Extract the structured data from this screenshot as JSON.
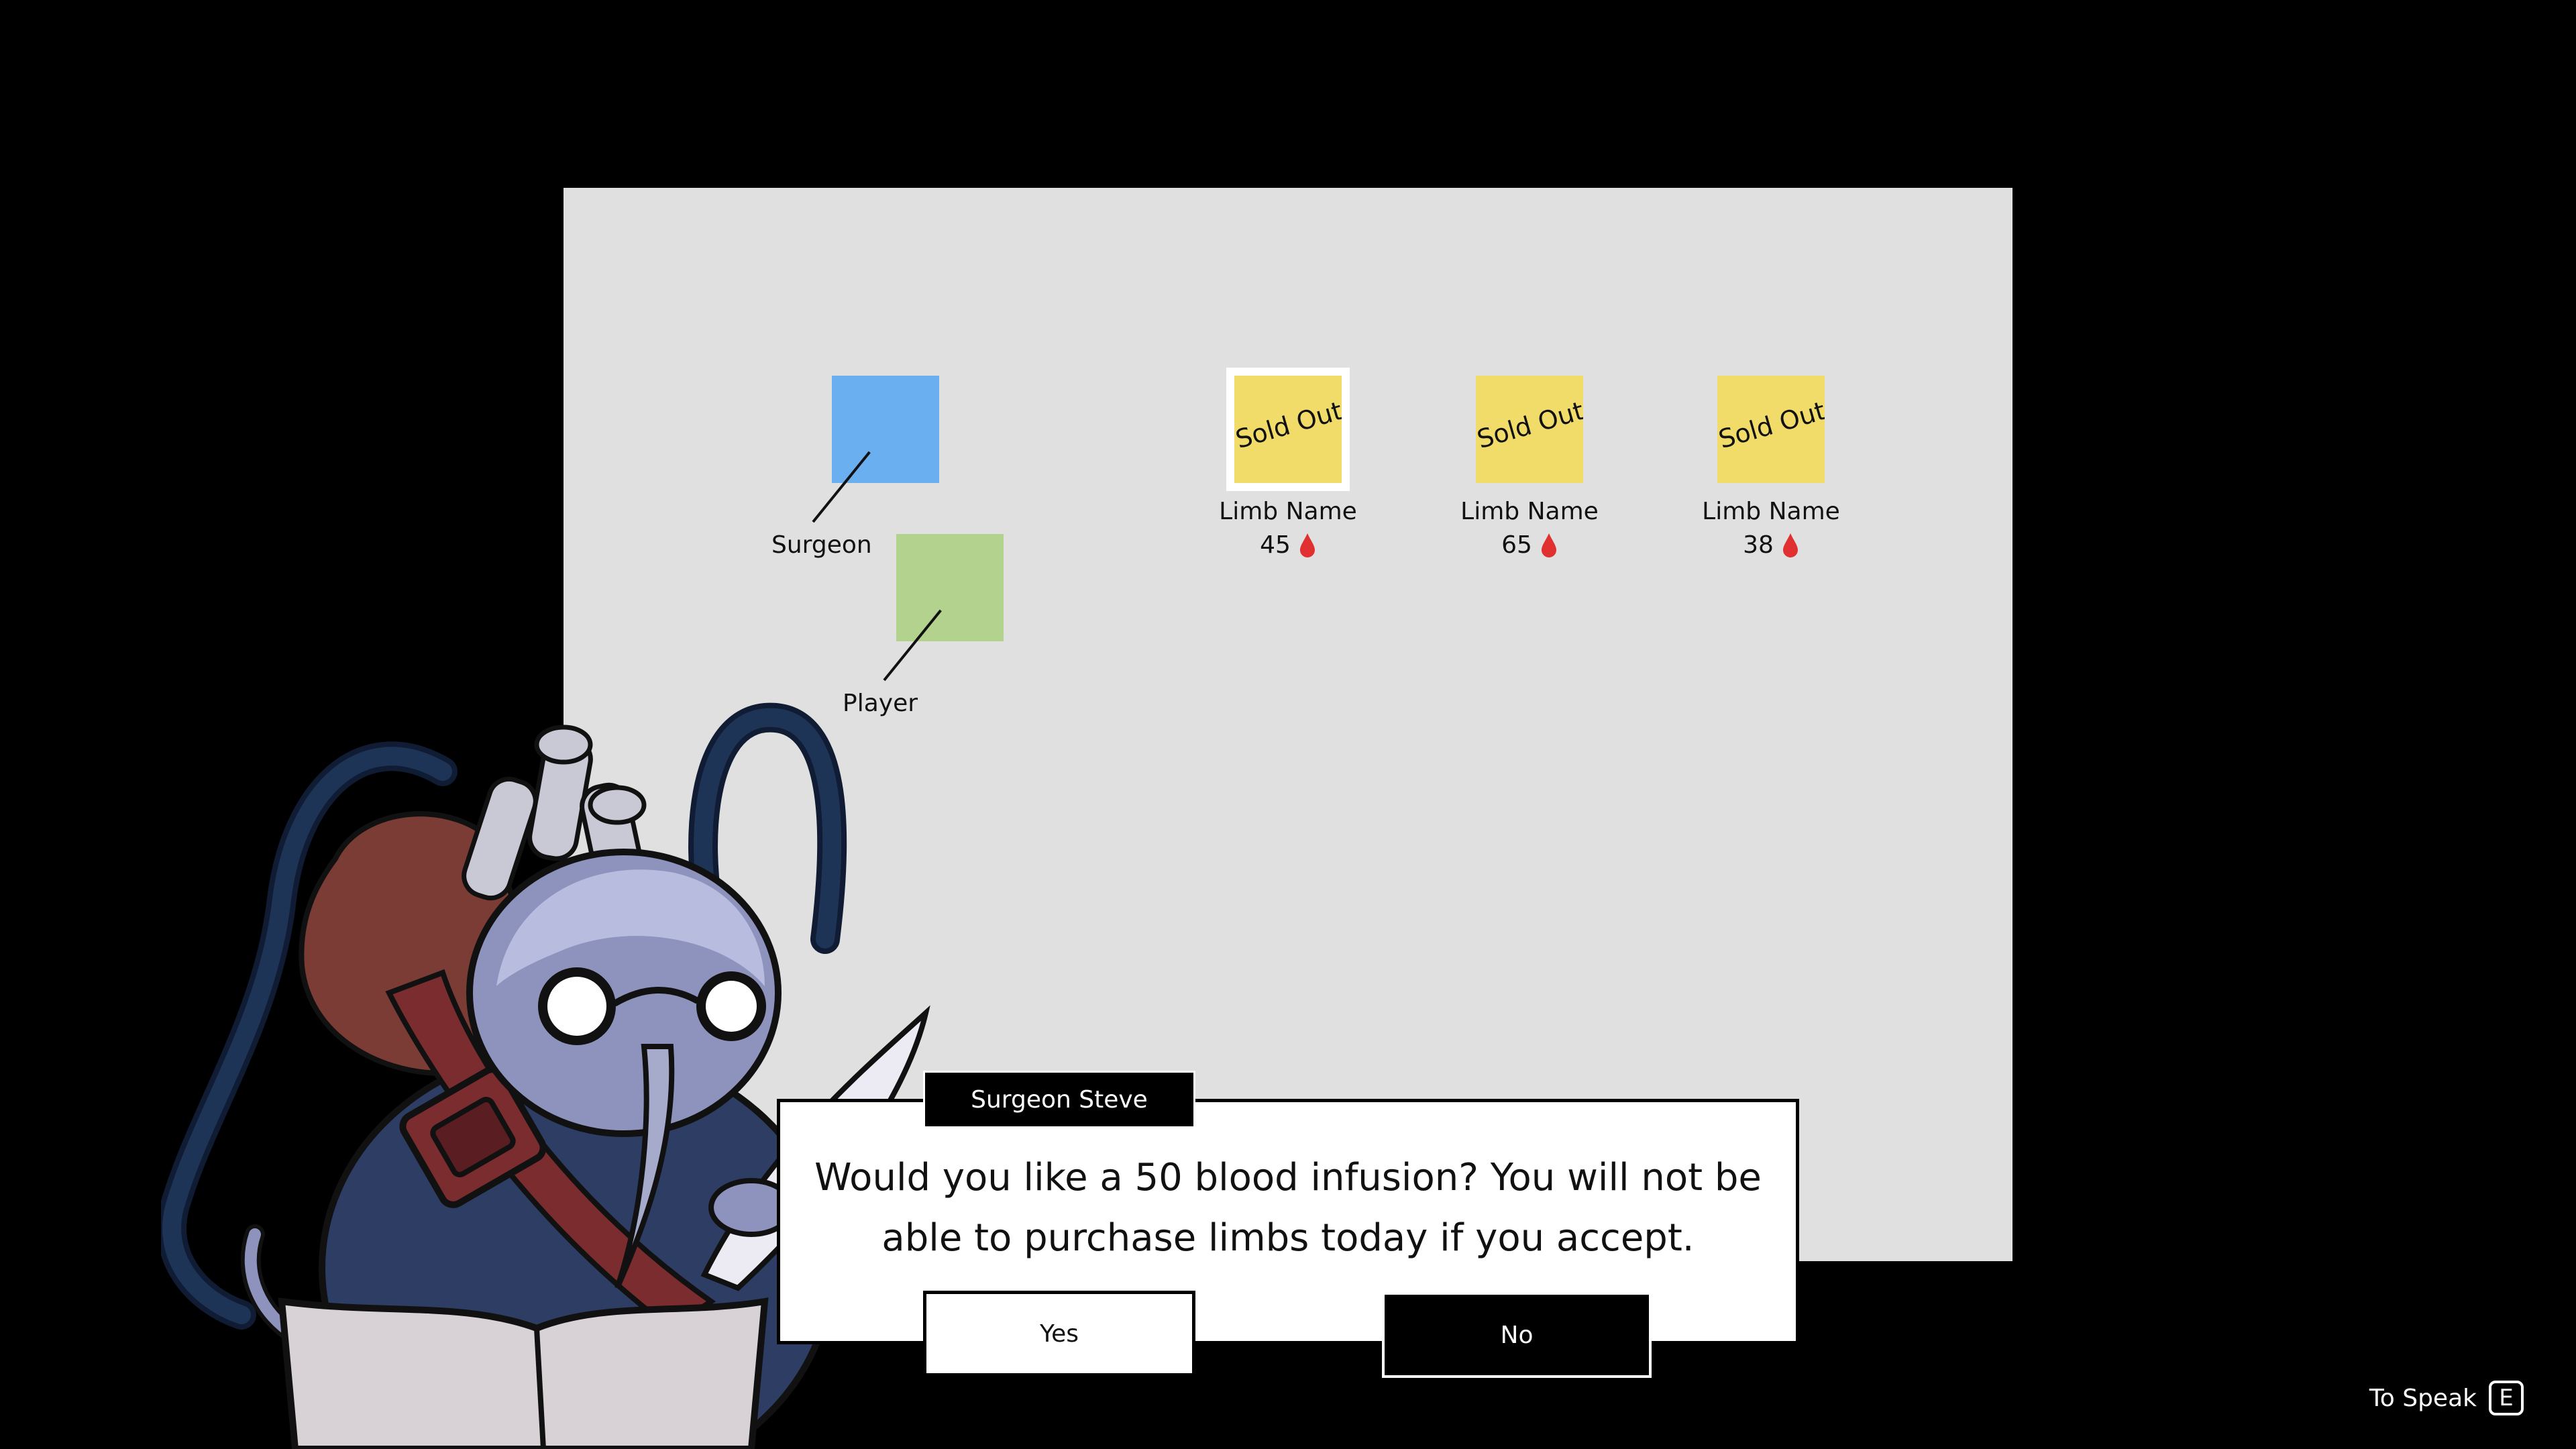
{
  "map": {
    "surgeon_label": "Surgeon",
    "player_label": "Player",
    "surgeon_color": "#6aaff0",
    "player_color": "#b3d28e"
  },
  "shop": {
    "items": [
      {
        "status": "Sold Out",
        "name": "Limb Name",
        "price": "45",
        "selected": true
      },
      {
        "status": "Sold Out",
        "name": "Limb Name",
        "price": "65",
        "selected": false
      },
      {
        "status": "Sold Out",
        "name": "Limb Name",
        "price": "38",
        "selected": false
      }
    ],
    "card_color": "#f1dc6a",
    "currency_icon": "blood-drop-icon",
    "currency_color": "#e03030"
  },
  "dialog": {
    "speaker": "Surgeon Steve",
    "text": "Would you like a 50 blood infusion?  You will not be able to purchase limbs today if you accept.",
    "yes_label": "Yes",
    "no_label": "No"
  },
  "prompt": {
    "label": "To Speak",
    "key": "E"
  }
}
